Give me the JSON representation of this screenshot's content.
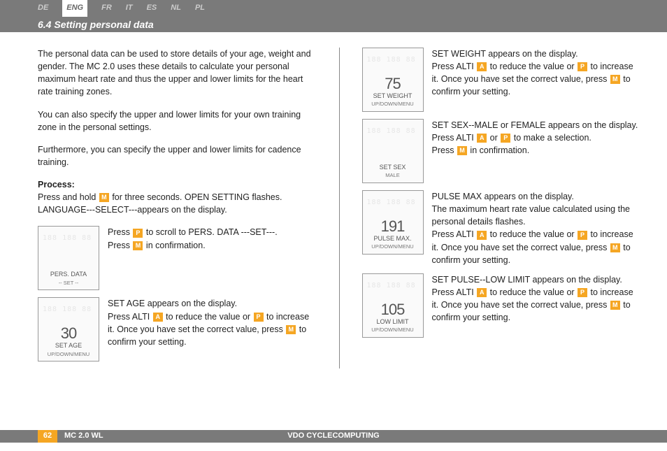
{
  "languages": [
    {
      "code": "DE",
      "active": false
    },
    {
      "code": "ENG",
      "active": true
    },
    {
      "code": "FR",
      "active": false
    },
    {
      "code": "IT",
      "active": false
    },
    {
      "code": "ES",
      "active": false
    },
    {
      "code": "NL",
      "active": false
    },
    {
      "code": "PL",
      "active": false
    }
  ],
  "section_title": "6.4 Setting personal data",
  "intro": {
    "p1": "The personal data can be used to store details of your age, weight and gender. The MC 2.0 uses these details to calculate your personal maximum heart rate and thus the upper and lower limits for the heart rate training zones.",
    "p2": "You can also specify the upper and lower limits for your own training zone in the personal settings.",
    "p3": "Furthermore, you can specify the upper and lower limits for cadence training."
  },
  "process_label": "Process:",
  "process": {
    "hold_pre": "Press and hold ",
    "hold_post": " for three seconds. OPEN SETTING flashes. LANGUAGE---SELECT---appears on the display."
  },
  "buttons": {
    "M": "M",
    "P": "P",
    "A": "A"
  },
  "left_steps": [
    {
      "lcd": {
        "value": "",
        "line1": "PERS. DATA",
        "line2": "--  SET  --"
      },
      "parts": [
        {
          "t": "Press "
        },
        {
          "b": "P"
        },
        {
          "t": " to scroll to PERS. DATA ---SET---."
        },
        {
          "br": true
        },
        {
          "t": "Press "
        },
        {
          "b": "M"
        },
        {
          "t": " in confirmation."
        }
      ]
    },
    {
      "lcd": {
        "value": "30",
        "line1": "SET AGE",
        "line2": "UP/DOWN/MENU"
      },
      "parts": [
        {
          "t": "SET AGE appears on the display."
        },
        {
          "br": true
        },
        {
          "t": "Press ALTI "
        },
        {
          "b": "A"
        },
        {
          "t": " to reduce the value or "
        },
        {
          "b": "P"
        },
        {
          "t": " to increase it. Once you have set the correct value, press "
        },
        {
          "b": "M"
        },
        {
          "t": " to confirm your setting."
        }
      ]
    }
  ],
  "right_steps": [
    {
      "lcd": {
        "value": "75",
        "line1": "SET WEIGHT",
        "line2": "UP/DOWN/MENU"
      },
      "parts": [
        {
          "t": "SET WEIGHT appears on the display."
        },
        {
          "br": true
        },
        {
          "t": "Press ALTI "
        },
        {
          "b": "A"
        },
        {
          "t": " to reduce the value or "
        },
        {
          "b": "P"
        },
        {
          "t": " to increase it. Once you have set the correct value, press "
        },
        {
          "b": "M"
        },
        {
          "t": " to confirm your setting."
        }
      ]
    },
    {
      "lcd": {
        "value": "",
        "line1": "SET  SEX",
        "line2": "MALE"
      },
      "parts": [
        {
          "t": "SET SEX--MALE or FEMALE appears on the display."
        },
        {
          "br": true
        },
        {
          "t": "Press ALTI "
        },
        {
          "b": "A"
        },
        {
          "t": " or "
        },
        {
          "b": "P"
        },
        {
          "t": " to make a selection."
        },
        {
          "br": true
        },
        {
          "t": "Press "
        },
        {
          "b": "M"
        },
        {
          "t": " in confirmation."
        }
      ]
    },
    {
      "lcd": {
        "value": "191",
        "line1": "PULSE MAX.",
        "line2": "UP/DOWN/MENU"
      },
      "parts": [
        {
          "t": "PULSE MAX appears on the display."
        },
        {
          "br": true
        },
        {
          "t": "The maximum heart rate value calculated using the personal details flashes."
        },
        {
          "br": true
        },
        {
          "t": "Press ALTI "
        },
        {
          "b": "A"
        },
        {
          "t": " to reduce the value or "
        },
        {
          "b": "P"
        },
        {
          "t": " to increase it. Once you have set the correct value, press "
        },
        {
          "b": "M"
        },
        {
          "t": " to confirm your setting."
        }
      ]
    },
    {
      "lcd": {
        "value": "105",
        "line1": "LOW LIMIT",
        "line2": "UP/DOWN/MENU"
      },
      "parts": [
        {
          "t": "SET PULSE--LOW LIMIT appears on the display."
        },
        {
          "br": true
        },
        {
          "t": "Press ALTI "
        },
        {
          "b": "A"
        },
        {
          "t": " to reduce the value or "
        },
        {
          "b": "P"
        },
        {
          "t": " to increase it. Once you have set the correct value, press "
        },
        {
          "b": "M"
        },
        {
          "t": " to confirm your setting."
        }
      ]
    }
  ],
  "footer": {
    "page": "62",
    "model": "MC 2.0 WL",
    "brand": "VDO CYCLECOMPUTING"
  }
}
